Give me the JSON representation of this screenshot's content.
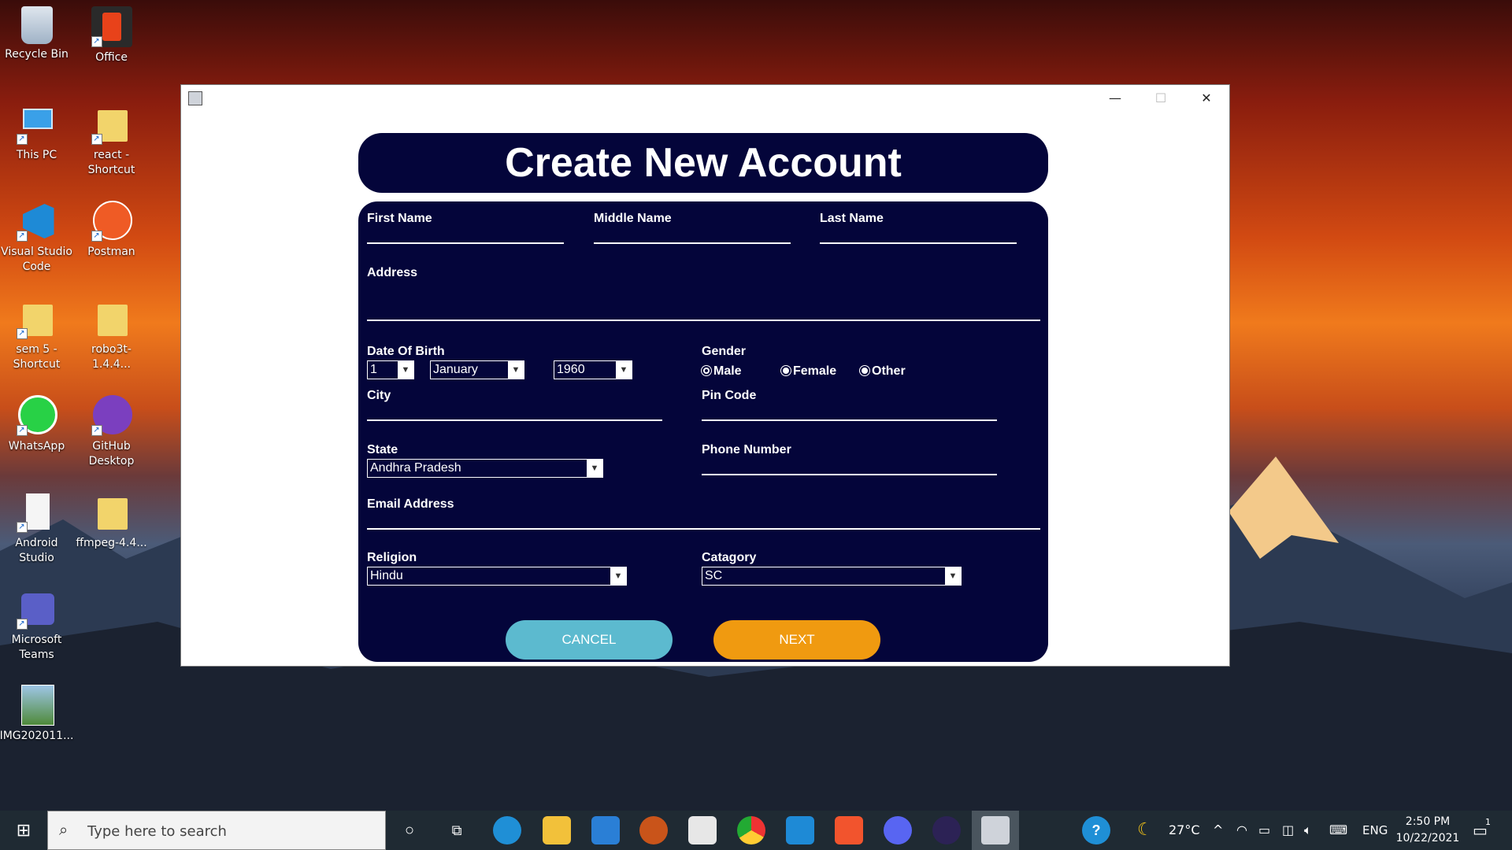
{
  "desktop": {
    "icons": [
      {
        "label": "Recycle Bin",
        "icon": "recycle-bin-icon"
      },
      {
        "label": "Office",
        "icon": "office-icon"
      },
      {
        "label": "This PC",
        "icon": "computer-icon"
      },
      {
        "label": "react - Shortcut",
        "icon": "folder-icon"
      },
      {
        "label": "Visual Studio Code",
        "icon": "vscode-icon"
      },
      {
        "label": "Postman",
        "icon": "postman-icon"
      },
      {
        "label": "sem 5 - Shortcut",
        "icon": "folder-icon"
      },
      {
        "label": "robo3t-1.4.4...",
        "icon": "folder-icon"
      },
      {
        "label": "WhatsApp",
        "icon": "whatsapp-icon"
      },
      {
        "label": "GitHub Desktop",
        "icon": "github-icon"
      },
      {
        "label": "Android Studio",
        "icon": "file-icon"
      },
      {
        "label": "ffmpeg-4.4...",
        "icon": "folder-icon"
      },
      {
        "label": "Microsoft Teams",
        "icon": "teams-icon"
      },
      {
        "label": "IMG202011...",
        "icon": "image-icon"
      }
    ]
  },
  "window": {
    "title": "",
    "controls": {
      "minimize": "—",
      "maximize": "☐",
      "close": "✕"
    }
  },
  "form": {
    "heading": "Create New Account",
    "first_name_label": "First Name",
    "middle_name_label": "Middle Name",
    "last_name_label": "Last Name",
    "address_label": "Address",
    "dob_label": "Date Of Birth",
    "dob_day": "1",
    "dob_month": "January",
    "dob_year": "1960",
    "gender_label": "Gender",
    "gender_options": [
      "Male",
      "Female",
      "Other"
    ],
    "gender_selected": "Male",
    "city_label": "City",
    "pin_label": "Pin Code",
    "state_label": "State",
    "state_value": "Andhra Pradesh",
    "phone_label": "Phone Number",
    "email_label": "Email Address",
    "religion_label": "Religion",
    "religion_value": "Hindu",
    "category_label": "Catagory",
    "category_value": "SC",
    "cancel_label": "CANCEL",
    "next_label": "NEXT",
    "colors": {
      "panel": "#04053a",
      "cancel": "#5cbacf",
      "next": "#f09a10"
    }
  },
  "taskbar": {
    "search_placeholder": "Type here to search",
    "weather": "27°C",
    "language": "ENG",
    "time": "2:50 PM",
    "date": "10/22/2021",
    "notification_count": "1"
  }
}
